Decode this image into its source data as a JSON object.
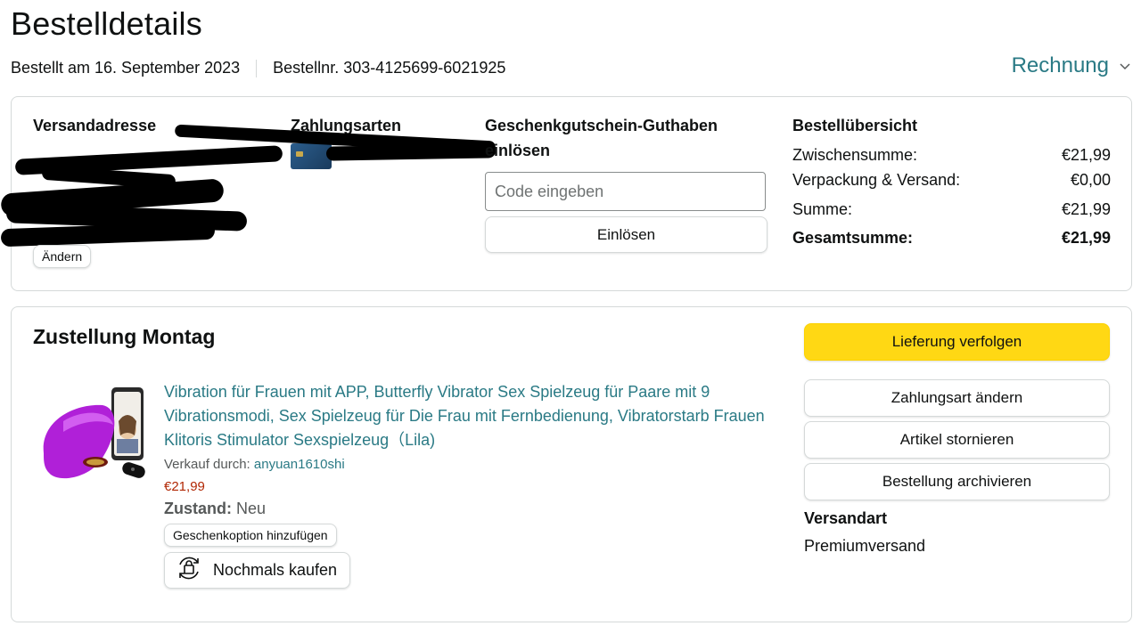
{
  "header": {
    "title": "Bestelldetails",
    "ordered_on": "Bestellt am 16. September 2023",
    "order_number": "Bestellnr. 303-4125699-6021925",
    "invoice_label": "Rechnung"
  },
  "shipping": {
    "heading": "Versandadresse",
    "change_label": "Ändern"
  },
  "payment": {
    "heading": "Zahlungsarten"
  },
  "gift_card": {
    "heading": "Geschenkgutschein-Guthaben einlösen",
    "input_placeholder": "Code eingeben",
    "redeem_label": "Einlösen"
  },
  "summary": {
    "heading": "Bestellübersicht",
    "rows": [
      {
        "label": "Zwischensumme:",
        "value": "€21,99"
      },
      {
        "label": "Verpackung & Versand:",
        "value": "€0,00"
      },
      {
        "label": "Summe:",
        "value": "€21,99"
      }
    ],
    "total_label": "Gesamtsumme:",
    "total_value": "€21,99"
  },
  "delivery": {
    "title": "Zustellung Montag",
    "product_title": "Vibration für Frauen mit APP, Butterfly Vibrator Sex Spielzeug für Paare mit 9 Vibrationsmodi, Sex Spielzeug für Die Frau mit Fernbedienung, Vibratorstarb Frauen Klitoris Stimulator Sexspielzeug（Lila)",
    "seller_prefix": "Verkauf durch: ",
    "seller_name": "anyuan1610shi",
    "price": "€21,99",
    "condition_label": "Zustand:",
    "condition_value": "Neu",
    "gift_option_label": "Geschenkoption hinzufügen",
    "buy_again_label": "Nochmals kaufen"
  },
  "actions": {
    "track": "Lieferung verfolgen",
    "change_payment": "Zahlungsart ändern",
    "cancel_items": "Artikel stornieren",
    "archive_order": "Bestellung archivieren",
    "shipping_type_label": "Versandart",
    "shipping_type_value": "Premiumversand"
  },
  "colors": {
    "link": "#2a7a85",
    "price": "#b12704",
    "primary_button": "#ffd814",
    "border": "#d5d9d9"
  }
}
